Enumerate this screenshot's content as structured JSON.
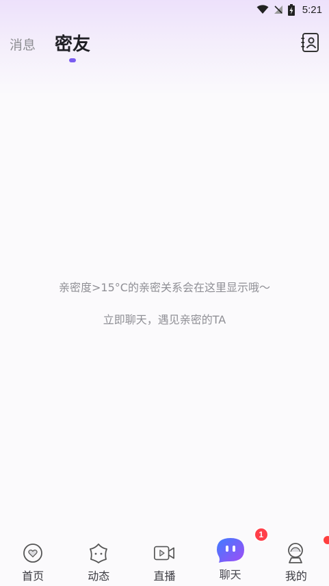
{
  "status_bar": {
    "time": "5:21",
    "icons": [
      "wifi-icon",
      "no-signal-icon",
      "battery-charging-icon"
    ]
  },
  "header": {
    "tabs": [
      {
        "label": "消息",
        "active": false
      },
      {
        "label": "密友",
        "active": true
      }
    ],
    "action_icon": "contacts-book-icon"
  },
  "empty_state": {
    "line1": "亲密度>15°C的亲密关系会在这里显示哦～",
    "line2": "立即聊天，遇见亲密的TA"
  },
  "bottom_nav": {
    "items": [
      {
        "label": "首页",
        "icon": "home-heart-icon"
      },
      {
        "label": "动态",
        "icon": "moments-star-icon"
      },
      {
        "label": "直播",
        "icon": "live-video-icon"
      },
      {
        "label": "聊天",
        "icon": "chat-bubble-icon",
        "active": true,
        "badge": "1"
      },
      {
        "label": "我的",
        "icon": "profile-avatar-icon",
        "dot": true
      }
    ]
  },
  "colors": {
    "accent": "#7a5cf0",
    "badge": "#ff3e49",
    "chat_gradient_start": "#3f7cff",
    "chat_gradient_end": "#a14cf5"
  }
}
